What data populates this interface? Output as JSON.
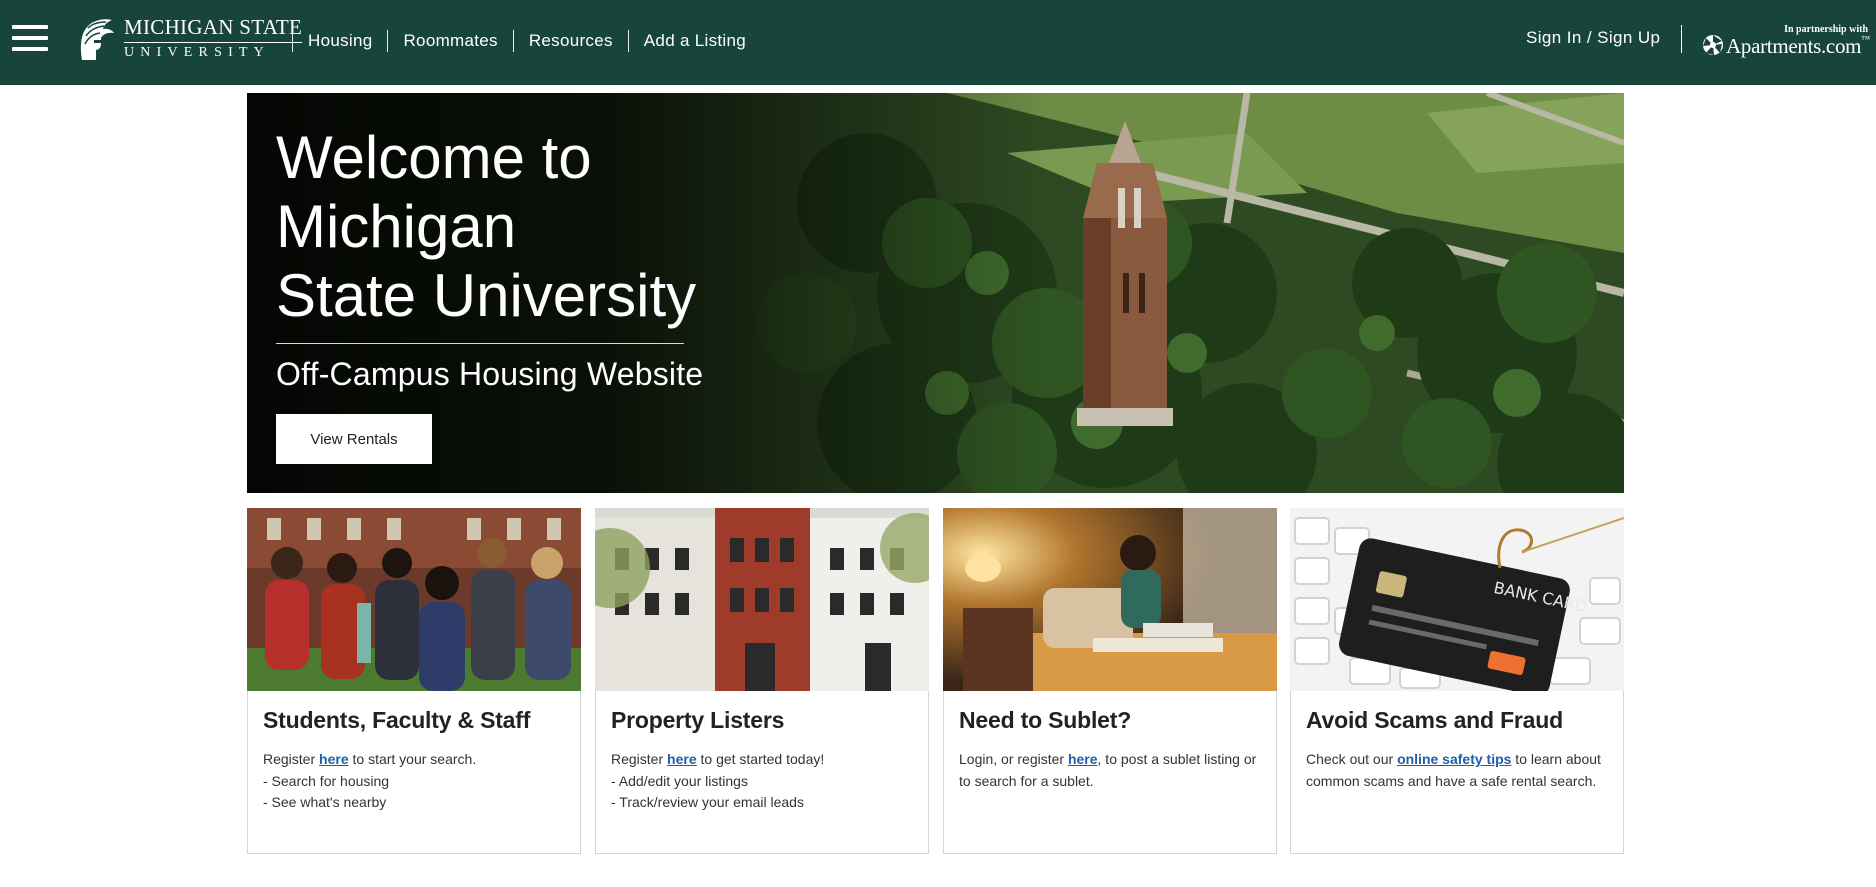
{
  "header": {
    "logo": {
      "line1": "MICHIGAN STATE",
      "line2": "UNIVERSITY"
    },
    "nav": [
      {
        "label": "Housing"
      },
      {
        "label": "Roommates"
      },
      {
        "label": "Resources"
      },
      {
        "label": "Add a Listing"
      }
    ],
    "signin_label": "Sign In / Sign Up",
    "partner": {
      "prefix": "In partnership with",
      "brand": "Apartments.com",
      "tm": "™"
    }
  },
  "hero": {
    "title_lines": [
      "Welcome to",
      "Michigan",
      "State University"
    ],
    "subtitle": "Off-Campus Housing Website",
    "button_label": "View Rentals"
  },
  "cards": [
    {
      "title": "Students, Faculty & Staff",
      "lead_pre": "Register ",
      "link": "here",
      "lead_post": " to start your search.",
      "bullets": [
        "- Search for housing",
        "- See what's nearby"
      ]
    },
    {
      "title": "Property Listers",
      "lead_pre": "Register ",
      "link": "here",
      "lead_post": " to get started today!",
      "bullets": [
        "- Add/edit your listings",
        "- Track/review your email leads"
      ]
    },
    {
      "title": "Need to Sublet?",
      "lead_pre": "Login, or register ",
      "link": "here",
      "lead_post": ", to post a sublet listing or to search for a sublet.",
      "bullets": []
    },
    {
      "title": "Avoid Scams and Fraud",
      "lead_pre": "Check out our ",
      "link": "online safety tips",
      "lead_post": " to learn about common scams and have a safe rental search.",
      "bullets": []
    }
  ],
  "card_image_text": {
    "bank_card": "BANK CARD"
  },
  "colors": {
    "brand_green": "#18453b",
    "link_blue": "#1f5fa8"
  }
}
